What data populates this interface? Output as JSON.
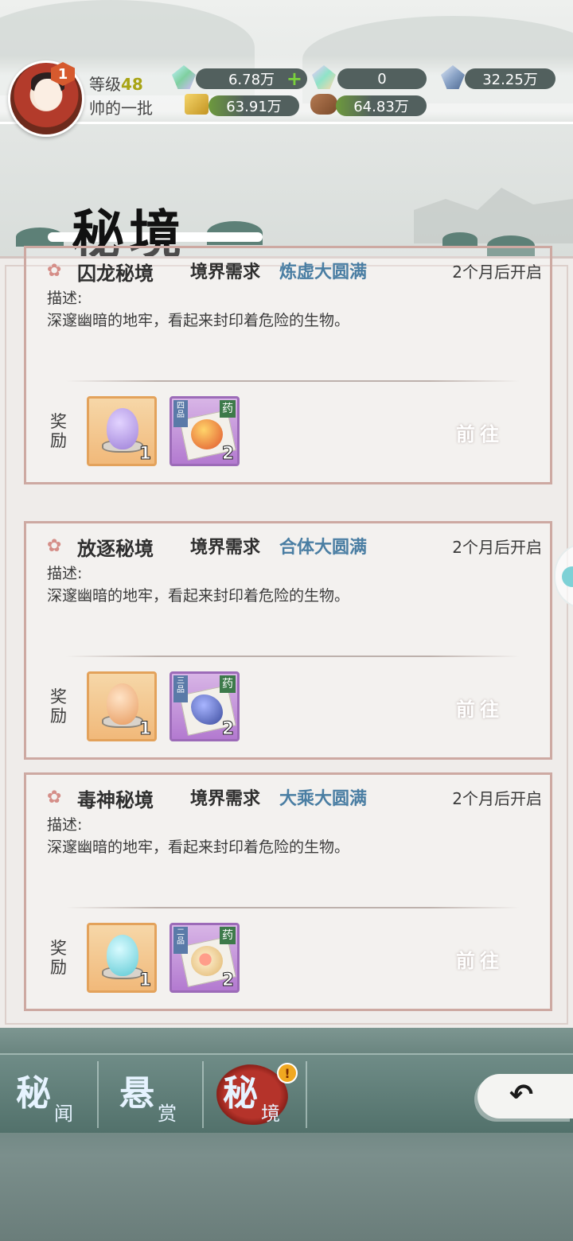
{
  "header": {
    "vip_level": "1",
    "level_label": "等级",
    "level_value": "48",
    "player_name": "帅的一批",
    "resources": {
      "spirit_stone": "6.78万",
      "premium_stone": "0",
      "crystal": "32.25万",
      "gold": "63.91万",
      "wood": "64.83万"
    }
  },
  "page_title": "秘境",
  "cards": [
    {
      "name": "囚龙秘境",
      "req_label": "境界需求",
      "req_value": "炼虚大圆满",
      "open_time": "2个月后开启",
      "desc_label": "描述:",
      "desc": "深邃幽暗的地牢，看起来封印着危险的生物。",
      "reward_label": "奖励",
      "rewards": [
        {
          "icon": "purple-egg-stone",
          "count": "1"
        },
        {
          "icon": "grade-4-herb",
          "grade": "四品",
          "tag": "药",
          "count": "2"
        }
      ],
      "go_label": "前往"
    },
    {
      "name": "放逐秘境",
      "req_label": "境界需求",
      "req_value": "合体大圆满",
      "open_time": "2个月后开启",
      "desc_label": "描述:",
      "desc": "深邃幽暗的地牢，看起来封印着危险的生物。",
      "reward_label": "奖励",
      "rewards": [
        {
          "icon": "orange-egg-stone",
          "count": "1"
        },
        {
          "icon": "grade-3-herb",
          "grade": "三品",
          "tag": "药",
          "count": "2"
        }
      ],
      "go_label": "前往"
    },
    {
      "name": "毒神秘境",
      "req_label": "境界需求",
      "req_value": "大乘大圆满",
      "open_time": "2个月后开启",
      "desc_label": "描述:",
      "desc": "深邃幽暗的地牢，看起来封印着危险的生物。",
      "reward_label": "奖励",
      "rewards": [
        {
          "icon": "cyan-egg-stone",
          "count": "1"
        },
        {
          "icon": "grade-2-herb",
          "grade": "二品",
          "tag": "药",
          "count": "2"
        }
      ],
      "go_label": "前往"
    }
  ],
  "nav": [
    {
      "big": "秘",
      "small": "闻"
    },
    {
      "big": "悬",
      "small": "赏"
    },
    {
      "big": "秘",
      "small": "境"
    }
  ],
  "alert_badge": "!",
  "back_icon": "back-arrow-icon",
  "colors": {
    "requirement_text": "#4a7ea3",
    "card_border": "#cda9a2",
    "nav_active": "#b5332a"
  }
}
